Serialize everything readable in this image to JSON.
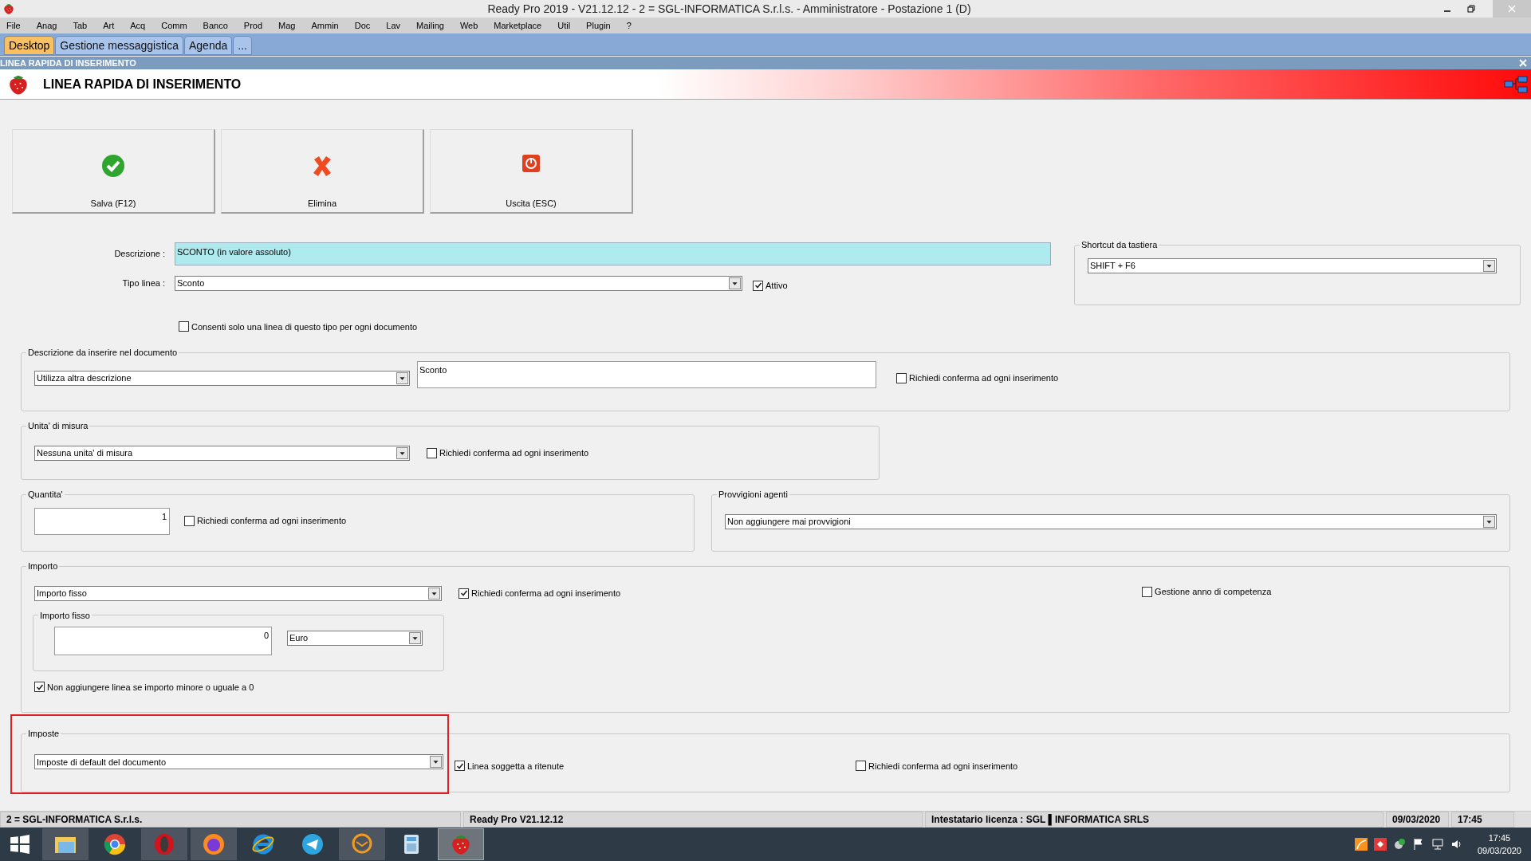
{
  "window": {
    "title": "Ready Pro 2019 - V21.12.12 - 2 = SGL-INFORMATICA S.r.l.s. - Amministratore - Postazione 1 (D)"
  },
  "menu": [
    "File",
    "Anag",
    "Tab",
    "Art",
    "Acq",
    "Comm",
    "Banco",
    "Prod",
    "Mag",
    "Ammin",
    "Doc",
    "Lav",
    "Mailing",
    "Web",
    "Marketplace",
    "Util",
    "Plugin",
    "?"
  ],
  "tabs": [
    {
      "label": "Desktop",
      "selected": true
    },
    {
      "label": "Gestione messaggistica",
      "selected": false
    },
    {
      "label": "Agenda",
      "selected": false
    },
    {
      "label": "...",
      "selected": false
    }
  ],
  "panel": {
    "title": "LINEA RAPIDA DI INSERIMENTO",
    "heading": "LINEA RAPIDA DI INSERIMENTO"
  },
  "toolbar": [
    {
      "label": "Salva (F12)",
      "kind": "save"
    },
    {
      "label": "Elimina",
      "kind": "delete"
    },
    {
      "label": "Uscita (ESC)",
      "kind": "exit"
    }
  ],
  "form": {
    "descrizione": {
      "label": "Descrizione :",
      "value": "SCONTO (in valore assoluto)"
    },
    "tipo_linea": {
      "label": "Tipo linea :",
      "value": "Sconto"
    },
    "attivo": {
      "label": "Attivo",
      "checked": true
    },
    "consenti": {
      "label": "Consenti solo una linea di questo tipo per ogni documento",
      "checked": false
    },
    "shortcut": {
      "title": "Shortcut da tastiera",
      "value": "SHIFT + F6"
    },
    "descrizione_documento": {
      "title": "Descrizione da inserire nel documento",
      "select": "Utilizza altra descrizione",
      "text": "Sconto",
      "confirm": {
        "label": "Richiedi conferma ad ogni inserimento",
        "checked": false
      }
    },
    "unita": {
      "title": "Unita' di misura",
      "select": "Nessuna unita' di misura",
      "confirm": {
        "label": "Richiedi conferma ad ogni inserimento",
        "checked": false
      }
    },
    "quantita": {
      "title": "Quantita'",
      "value": "1",
      "confirm": {
        "label": "Richiedi conferma ad ogni inserimento",
        "checked": false
      }
    },
    "provvigioni": {
      "title": "Provvigioni agenti",
      "select": "Non aggiungere mai provvigioni"
    },
    "importo": {
      "title": "Importo",
      "select": "Importo fisso",
      "confirm": {
        "label": "Richiedi conferma ad ogni inserimento",
        "checked": true
      },
      "competenza": {
        "label": "Gestione anno di competenza",
        "checked": false
      },
      "fisso": {
        "title": "Importo fisso",
        "value": "0",
        "currency": "Euro"
      },
      "non_aggiungere": {
        "label": "Non aggiungere linea se importo minore o uguale a 0",
        "checked": true
      }
    },
    "imposte": {
      "title": "Imposte",
      "highlighted": true,
      "select": "Imposte di default del documento",
      "ritenute": {
        "label": "Linea soggetta a ritenute",
        "checked": true
      },
      "confirm": {
        "label": "Richiedi conferma ad ogni inserimento",
        "checked": false
      }
    }
  },
  "status_bar": [
    "2 = SGL-INFORMATICA S.r.l.s.",
    "Ready Pro V21.12.12",
    "Intestatario licenza : SGL ▌INFORMATICA SRLS",
    "09/03/2020",
    "17:45"
  ],
  "taskbar": {
    "apps": [
      {
        "kind": "folder",
        "running": true,
        "selected": false
      },
      {
        "kind": "chrome",
        "running": false,
        "selected": false
      },
      {
        "kind": "opera",
        "running": true,
        "selected": false
      },
      {
        "kind": "firefox",
        "running": true,
        "selected": false
      },
      {
        "kind": "ie",
        "running": false,
        "selected": false
      },
      {
        "kind": "telegram",
        "running": false,
        "selected": false
      },
      {
        "kind": "mail",
        "running": true,
        "selected": false
      },
      {
        "kind": "calculator",
        "running": false,
        "selected": false
      },
      {
        "kind": "strawberry",
        "running": true,
        "selected": true
      }
    ],
    "time": "17:45",
    "date": "09/03/2020"
  }
}
